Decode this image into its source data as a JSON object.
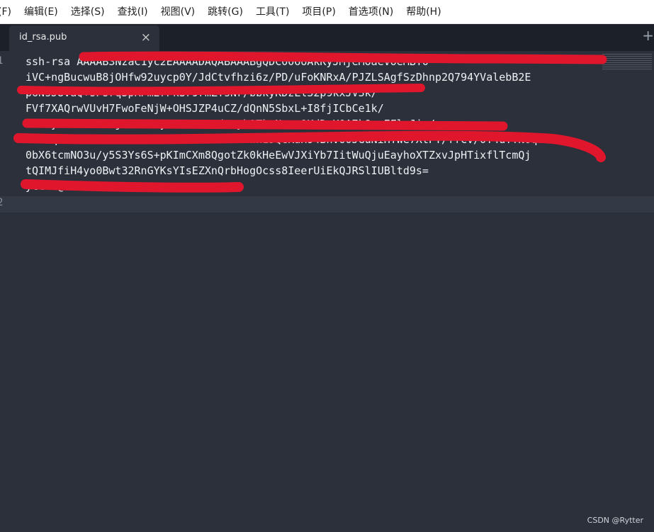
{
  "menu": [
    "(F)",
    "编辑(E)",
    "选择(S)",
    "查找(I)",
    "视图(V)",
    "跳转(G)",
    "工具(T)",
    "项目(P)",
    "首选项(N)",
    "帮助(H)"
  ],
  "tab": {
    "title": "id_rsa.pub",
    "close": "×",
    "new_tab": "+"
  },
  "gutter": {
    "line1": "1",
    "line2": "2"
  },
  "code_lines": [
    "ssh-rsa AAAAB3NzaC1yc2EAAAADAQABAAABgQDC006oAkKyJMjeMoaeVoeMBY0",
    "iVC+ngBucwuB8jOHfw92uycp0Y/JdCtvfhzi6z/PD/uFoKNRxA/PJZLSAgfSzDhnp2Q794YValebB2E",
    "p6NsJ8vaQ+sPsrq3pRPm2rPkSr9rmZTsNr/bbkyKDzLl32p9kxJV3k/",
    "FVf7XAQrwVUvH7FwoFeNjW+OHSJZP4uCZ/dQnN5SbxL+I8fjICbCe1k/",
    "WEFoyIz1ulX0lhjSlPt0sy5cC8e3eodueyb9TkoNucu9KdDcX0A7kQsmEFlaJiu/",
    "5GUxqM0kdEteYBKEfkZ0M0KC6kzSP2+wWJfwn1JQGKaH94Bhvo0JGuNiHTWe7XtPT/ffCV/0T4uTYNOqUP",
    "0bX6tcmNO3u/y5S3Ys6S+pKImCXm8QgotZk0kHeEwVJXiYb7IitWuQjuEayhoXTZxvJpHTixflTcmQj",
    "tQIMJfiH4yo0Bwt32RnGYKsYIsEZXnQrbHogOcss8IeerUiEkQJRSlIUBltd9s=",
    "ytter@..."
  ],
  "watermark": "CSDN @Rytter",
  "colors": {
    "redaction": "#e0162d",
    "editor_bg": "#2b303b",
    "tabbar_bg": "#1c2028"
  }
}
